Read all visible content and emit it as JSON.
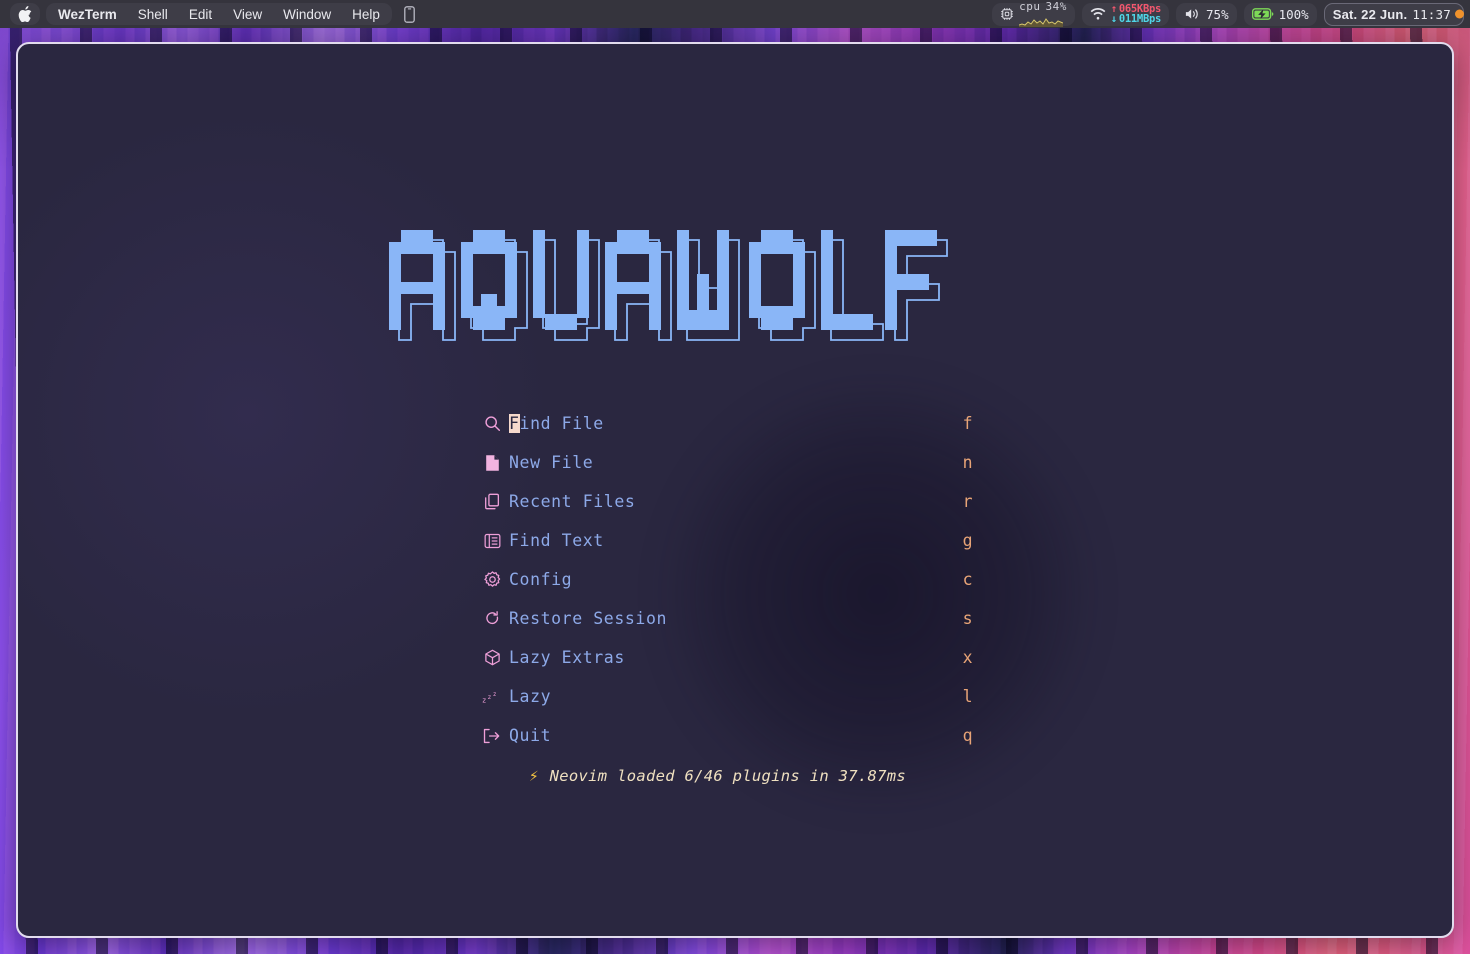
{
  "menubar": {
    "apple_icon": "apple-logo-icon",
    "app_menus": [
      {
        "label": "WezTerm",
        "bold": true
      },
      {
        "label": "Shell",
        "bold": false
      },
      {
        "label": "Edit",
        "bold": false
      },
      {
        "label": "View",
        "bold": false
      },
      {
        "label": "Window",
        "bold": false
      },
      {
        "label": "Help",
        "bold": false
      }
    ],
    "phone_icon": "iphone-icon",
    "status": {
      "cpu": {
        "icon": "cpu-chip-icon",
        "label": "cpu",
        "value": "34%",
        "graph_icon": "cpu-sparkline"
      },
      "network": {
        "icon": "wifi-icon",
        "upload": "065KBps",
        "download": "011MBps",
        "up_arrow": "arrow-up",
        "down_arrow": "arrow-down"
      },
      "volume": {
        "icon": "speaker-icon",
        "value": "75%"
      },
      "battery": {
        "icon": "battery-charging-icon",
        "value": "100%"
      },
      "clock": {
        "date": "Sat. 22 Jun.",
        "time": "11:37",
        "dot_icon": "status-dot"
      }
    }
  },
  "terminal": {
    "logo_text": "AQUAWOLF",
    "menu": [
      {
        "icon": "search-icon",
        "label_prefix": "F",
        "label_rest": "ind File",
        "key": "f"
      },
      {
        "icon": "new-file-icon",
        "label_prefix": "",
        "label_rest": "New File",
        "key": "n"
      },
      {
        "icon": "recent-files-icon",
        "label_prefix": "",
        "label_rest": "Recent Files",
        "key": "r"
      },
      {
        "icon": "find-text-icon",
        "label_prefix": "",
        "label_rest": "Find Text",
        "key": "g"
      },
      {
        "icon": "gear-icon",
        "label_prefix": "",
        "label_rest": "Config",
        "key": "c"
      },
      {
        "icon": "restore-session-icon",
        "label_prefix": "",
        "label_rest": "Restore Session",
        "key": "s"
      },
      {
        "icon": "package-cube-icon",
        "label_prefix": "",
        "label_rest": "Lazy Extras",
        "key": "x"
      },
      {
        "icon": "sleep-zzz-icon",
        "label_prefix": "",
        "label_rest": "Lazy",
        "key": "l"
      },
      {
        "icon": "quit-exit-icon",
        "label_prefix": "",
        "label_rest": "Quit",
        "key": "q"
      }
    ],
    "footer": {
      "bolt_icon": "lightning-bolt-icon",
      "text": "Neovim loaded 6/46 plugins in 37.87ms"
    }
  },
  "colors": {
    "terminal_bg": "#2a2740",
    "window_border": "#e2dcee",
    "logo_blue": "#8ab6f7",
    "menu_label": "#8da9e8",
    "menu_icon_pink": "#ee9fd8",
    "shortcut_orange": "#e8a477",
    "cursor_block": "#f6d9cc",
    "footer_text": "#efe0c0",
    "menubar_bg": "#35343d",
    "net_up": "#f2576e",
    "net_down": "#4fd6e8",
    "battery_green": "#7dd957",
    "clock_dot": "#f0922c"
  }
}
